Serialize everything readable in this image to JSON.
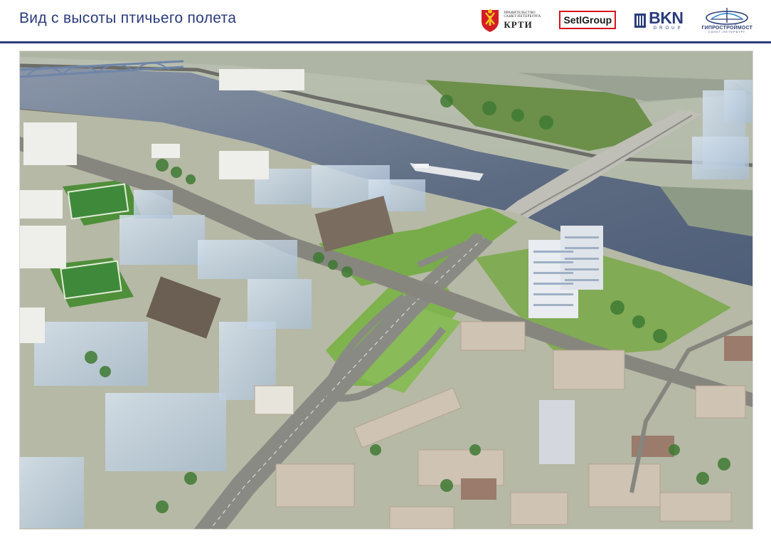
{
  "header": {
    "title": "Вид с высоты птичьего полета"
  },
  "logos": {
    "krti": {
      "line1": "ПРАВИТЕЛЬСТВО",
      "line2": "САНКТ-ПЕТЕРБУРГА",
      "name": "КРТИ"
    },
    "setl": {
      "part1": "Setl",
      "part2": "Group"
    },
    "bkn": {
      "name": "BKN",
      "sub": "GROUP"
    },
    "giprostroymost": {
      "name": "ГИПРОСТРОЙМОСТ",
      "sub": "САНКТ-ПЕТЕРБУРГ"
    }
  },
  "colors": {
    "header_text": "#2a3a7c",
    "rule": "#2b3d7a",
    "river": "#6f7d93",
    "grass": "#6fa848",
    "road": "#7d7d78"
  },
  "image": {
    "subject": "aerial-rendering"
  }
}
